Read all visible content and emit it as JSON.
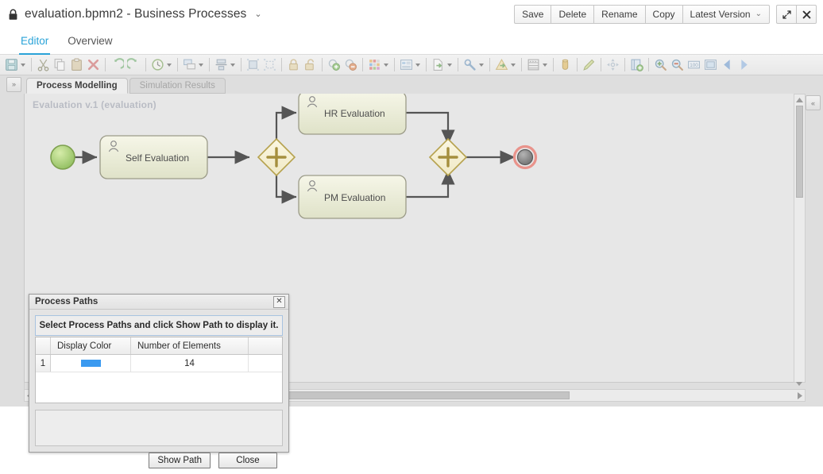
{
  "titlebar": {
    "lock_icon": "lock-icon",
    "document_title": "evaluation.bpmn2 - Business Processes",
    "title_caret": "⌄",
    "buttons": [
      {
        "label": "Save",
        "name": "save-button"
      },
      {
        "label": "Delete",
        "name": "delete-button"
      },
      {
        "label": "Rename",
        "name": "rename-button"
      },
      {
        "label": "Copy",
        "name": "copy-button"
      }
    ],
    "version_select": {
      "label": "Latest Version",
      "caret": "⌄"
    },
    "window_controls": [
      {
        "name": "maximize-icon",
        "glyph": "⤡"
      },
      {
        "name": "close-icon",
        "glyph": "✖"
      }
    ]
  },
  "main_tabs": [
    {
      "label": "Editor",
      "active": true
    },
    {
      "label": "Overview",
      "active": false
    }
  ],
  "toolbar": {
    "items": [
      {
        "name": "save-icon",
        "caret": true
      },
      {
        "sep": true
      },
      {
        "name": "cut-icon",
        "caret": false
      },
      {
        "name": "copy-icon",
        "caret": false
      },
      {
        "name": "paste-icon",
        "caret": false
      },
      {
        "name": "delete-icon",
        "caret": false
      },
      {
        "sep": true
      },
      {
        "name": "undo-icon",
        "caret": false
      },
      {
        "name": "redo-icon",
        "caret": false
      },
      {
        "sep": true
      },
      {
        "name": "history-icon",
        "caret": true
      },
      {
        "sep": true
      },
      {
        "name": "arrange-icon",
        "caret": true
      },
      {
        "sep": true
      },
      {
        "name": "align-icon",
        "caret": true
      },
      {
        "sep": true
      },
      {
        "name": "group-icon",
        "caret": false
      },
      {
        "name": "ungroup-icon",
        "caret": false
      },
      {
        "sep": true
      },
      {
        "name": "lock-closed-icon",
        "caret": false
      },
      {
        "name": "lock-open-icon",
        "caret": false
      },
      {
        "sep": true
      },
      {
        "name": "add-attachment-icon",
        "caret": false
      },
      {
        "name": "remove-attachment-icon",
        "caret": false
      },
      {
        "sep": true
      },
      {
        "name": "palette-icon",
        "caret": true
      },
      {
        "sep": true
      },
      {
        "name": "properties-icon",
        "caret": true
      },
      {
        "sep": true
      },
      {
        "name": "export-icon",
        "caret": true
      },
      {
        "sep": true
      },
      {
        "name": "configure-icon",
        "caret": true
      },
      {
        "sep": true
      },
      {
        "name": "validate-icon",
        "caret": true
      },
      {
        "sep": true
      },
      {
        "name": "simulate-icon",
        "caret": true
      },
      {
        "sep": true
      },
      {
        "name": "database-icon",
        "caret": false
      },
      {
        "sep": true
      },
      {
        "name": "edit-pencil-icon",
        "caret": false
      },
      {
        "sep": true
      },
      {
        "name": "move-icon",
        "caret": false
      },
      {
        "sep": true
      },
      {
        "name": "add-page-icon",
        "caret": false
      },
      {
        "sep": true
      },
      {
        "name": "zoom-in-icon",
        "caret": false
      },
      {
        "name": "zoom-out-icon",
        "caret": false
      },
      {
        "name": "zoom-100-icon",
        "caret": false
      },
      {
        "name": "fit-page-icon",
        "caret": false
      },
      {
        "name": "previous-page-icon",
        "caret": false
      },
      {
        "name": "next-page-icon",
        "caret": false
      }
    ]
  },
  "editor": {
    "expand_left_glyph": "»",
    "collapse_right_glyph": "«",
    "sub_tabs": [
      {
        "label": "Process Modelling",
        "active": true
      },
      {
        "label": "Simulation Results",
        "active": false
      }
    ],
    "canvas": {
      "diagram_label": "Evaluation v.1 (evaluation)",
      "background_color": "#e7e7e7",
      "nodes": [
        {
          "name": "start-event",
          "type": "start-event",
          "label": ""
        },
        {
          "name": "task-self-evaluation",
          "type": "user-task",
          "label": "Self Evaluation"
        },
        {
          "name": "gateway-split",
          "type": "parallel-gateway",
          "label": "+"
        },
        {
          "name": "task-hr-evaluation",
          "type": "user-task",
          "label": "HR Evaluation"
        },
        {
          "name": "task-pm-evaluation",
          "type": "user-task",
          "label": "PM Evaluation"
        },
        {
          "name": "gateway-join",
          "type": "parallel-gateway",
          "label": "+"
        },
        {
          "name": "end-event",
          "type": "end-event",
          "label": ""
        }
      ],
      "colors": {
        "task_fill_top": "#f4f4e4",
        "task_fill_bottom": "#e2e4cc",
        "gateway_fill": "#f7f2d8",
        "gateway_stroke": "#b6a24e",
        "start_fill": "#bcd98a",
        "end_stroke": "#e8948c",
        "connector": "#555555"
      }
    }
  },
  "dialog": {
    "title": "Process Paths",
    "close_glyph": "✕",
    "banner": "Select Process Paths and click Show Path to display it.",
    "table": {
      "columns": [
        "",
        "Display Color",
        "Number of Elements",
        ""
      ],
      "rows": [
        {
          "index": "1",
          "color": "#3b9af0",
          "elements": "14"
        }
      ]
    },
    "buttons": [
      {
        "label": "Show Path",
        "name": "show-path-button"
      },
      {
        "label": "Close",
        "name": "close-dialog-button"
      }
    ]
  }
}
